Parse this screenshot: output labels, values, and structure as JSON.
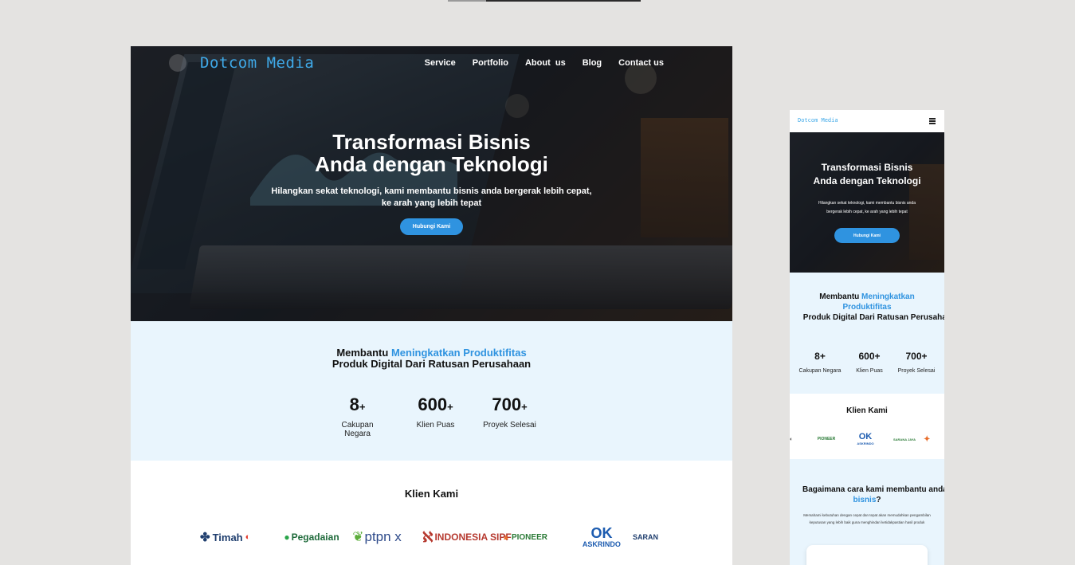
{
  "desktop": {
    "brand": "Dotcom Media",
    "nav": [
      "Service",
      "Portfolio",
      "About  us",
      "Blog",
      "Contact us"
    ],
    "hero": {
      "headline_line1": "Transformasi Bisnis",
      "headline_line2": "Anda dengan Teknologi",
      "sub_line1": "Hilangkan sekat teknologi, kami membantu bisnis anda bergerak lebih cepat,",
      "sub_line2": "ke arah yang lebih tepat",
      "cta": "Hubungi Kami"
    },
    "stats": {
      "title_prefix": "Membantu ",
      "title_accent": "Meningkatkan Produktifitas",
      "title_line2": "Produk Digital Dari Ratusan Perusahaan",
      "items": [
        {
          "num": "8",
          "plus": "+",
          "label": "Cakupan Negara"
        },
        {
          "num": "600",
          "plus": "+",
          "label": "Klien Puas"
        },
        {
          "num": "700",
          "plus": "+",
          "label": "Proyek Selesai"
        }
      ]
    },
    "clients": {
      "title": "Klien Kami",
      "logos": [
        "Timah",
        "Pegadaian",
        "ptpn x",
        "INDONESIA SIPF",
        "PIONEER",
        "ASKRINDO",
        "SARAN"
      ]
    }
  },
  "mobile": {
    "brand": "Dotcom Media",
    "hero": {
      "headline_line1": "Transformasi Bisnis",
      "headline_line2": "Anda dengan Teknologi",
      "sub_line1": "Hilangkan sekat teknologi, kami membantu bisnis anda",
      "sub_line2": "bergerak lebih cepat, ke arah yang lebih tepat",
      "cta": "Hubungi Kami"
    },
    "stats": {
      "title_prefix": "Membantu ",
      "title_accent": "Meningkatkan Produktifitas",
      "title_suffix": " Produk Digital Dari Ratusan Perusahaan",
      "items": [
        {
          "num": "8+",
          "label": "Cakupan Negara"
        },
        {
          "num": "600+",
          "label": "Klien Puas"
        },
        {
          "num": "700+",
          "label": "Proyek Selesai"
        }
      ]
    },
    "clients": {
      "title": "Klien Kami",
      "logos": [
        "PIONEER",
        "ASKRINDO",
        "SARANA JAYA"
      ]
    },
    "help": {
      "title_prefix": "Bagaimana cara kami membantu anda dalam ",
      "title_accent": "transformasi bisnis",
      "title_suffix": "?",
      "desc": "Memahami kebutuhan dengan cepat dan tepat akan memudahkan pengambilan keputusan yang lebih baik guna menghindari ketidakpastian hasil produk"
    }
  },
  "colors": {
    "accent": "#2f93e0",
    "brand": "#3fa9e8",
    "light_section": "#e9f5fd",
    "canvas": "#e4e3e1"
  },
  "icons": {
    "mobile_menu": "hamburger-icon"
  }
}
